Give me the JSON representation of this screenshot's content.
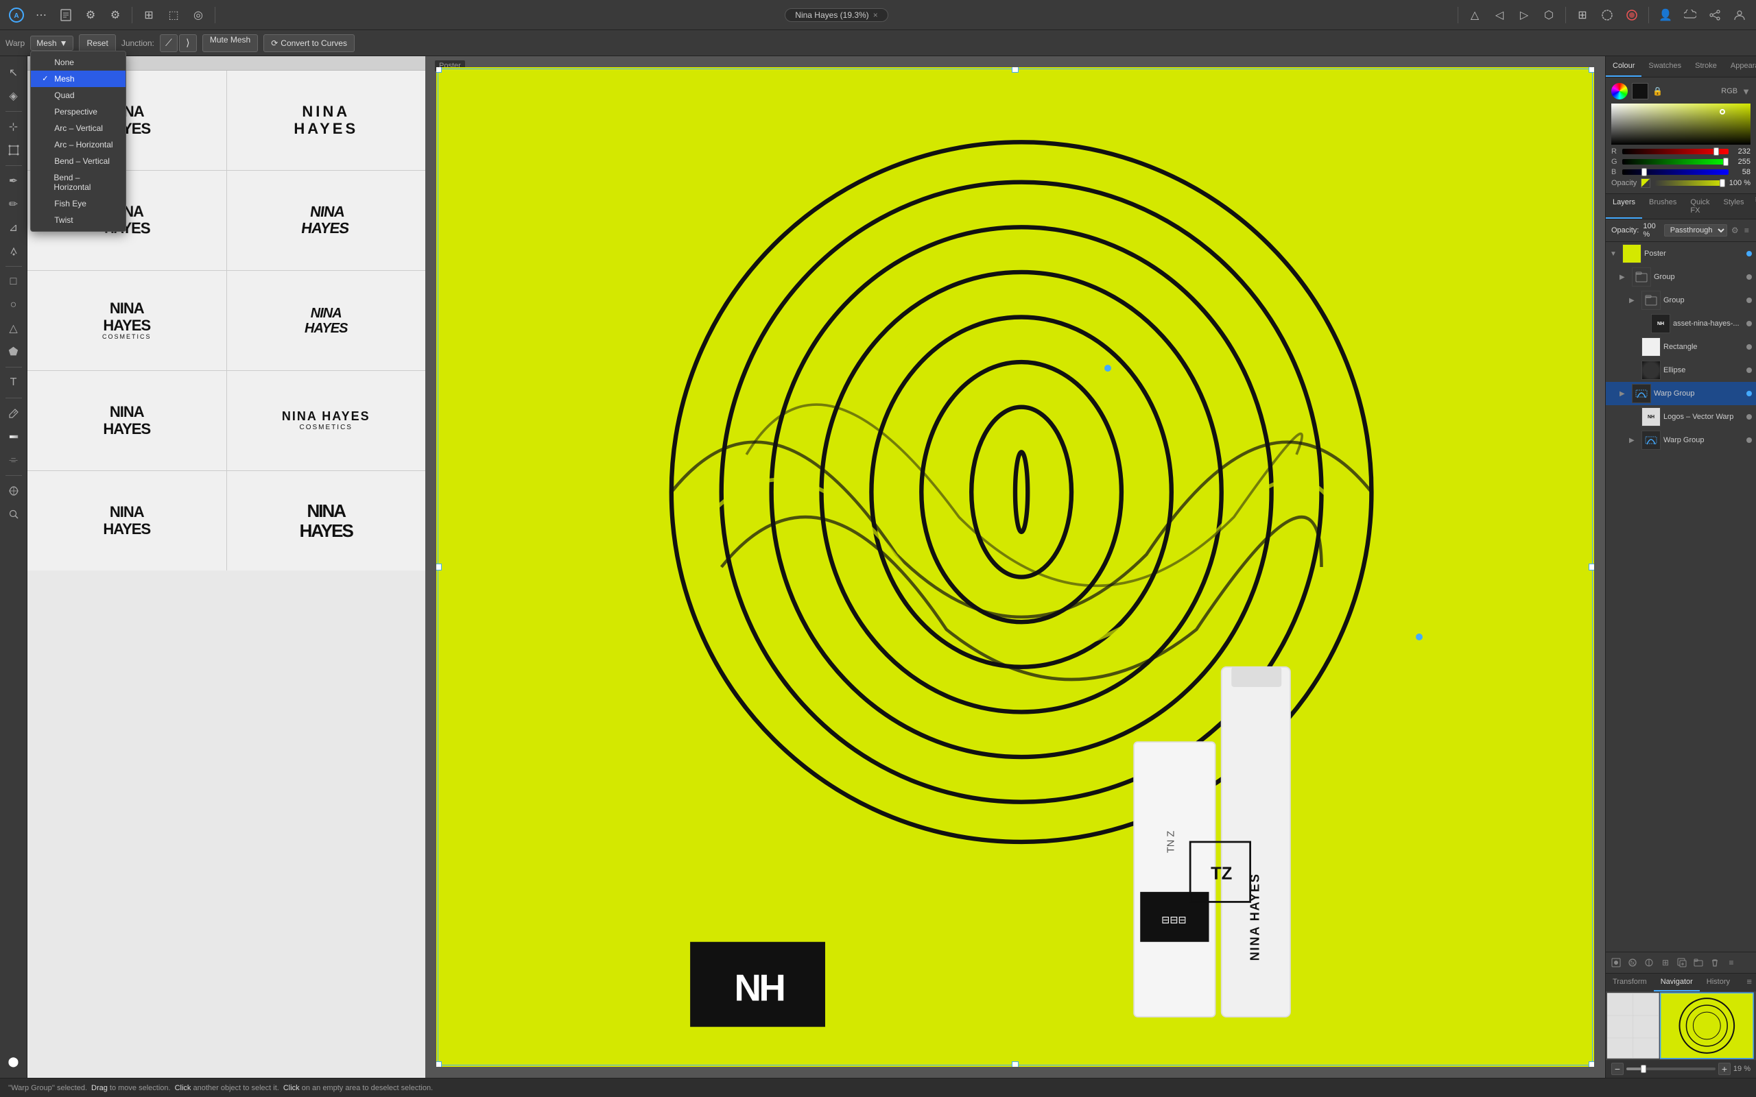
{
  "app": {
    "title": "Nina Hayes (19.3%)",
    "close_label": "×"
  },
  "top_toolbar": {
    "icons": [
      "⬡",
      "⊞",
      "⬚",
      "◎"
    ],
    "right_icons": [
      "△",
      "◁",
      "▷",
      "⬡",
      "✦",
      "☆",
      "⬡",
      "⬡",
      "⬡"
    ],
    "far_right_icons": [
      "👤",
      "🌐",
      "⚙"
    ]
  },
  "warp_toolbar": {
    "label": "Warp",
    "dropdown_label": "Mesh",
    "reset_label": "Reset",
    "junction_label": "Junction:",
    "mute_label": "Mute Mesh",
    "convert_label": "Convert to Curves",
    "menu_items": [
      {
        "id": "none",
        "label": "None",
        "active": false
      },
      {
        "id": "mesh",
        "label": "Mesh",
        "active": true
      },
      {
        "id": "quad",
        "label": "Quad",
        "active": false
      },
      {
        "id": "perspective",
        "label": "Perspective",
        "active": false
      },
      {
        "id": "arc-vertical",
        "label": "Arc – Vertical",
        "active": false
      },
      {
        "id": "arc-horizontal",
        "label": "Arc – Horizontal",
        "active": false
      },
      {
        "id": "bend-vertical",
        "label": "Bend – Vertical",
        "active": false
      },
      {
        "id": "bend-horizontal",
        "label": "Bend – Horizontal",
        "active": false
      },
      {
        "id": "fish-eye",
        "label": "Fish Eye",
        "active": false
      },
      {
        "id": "twist",
        "label": "Twist",
        "active": false
      }
    ]
  },
  "samples_panel": {
    "header": "Warp",
    "samples": [
      {
        "id": 1,
        "name": "NINA\nHAYES",
        "style": "normal"
      },
      {
        "id": 2,
        "name": "NINA\nHAYES",
        "style": "wide"
      },
      {
        "id": 3,
        "name": "NINA\nHAYES",
        "style": "slant"
      },
      {
        "id": 4,
        "name": "NINA\nHAYES",
        "style": "condensed"
      },
      {
        "id": 5,
        "name": "NINA\nHAYES\nCOSMETICS",
        "style": "sub"
      },
      {
        "id": 6,
        "name": "NINA\nHAYES",
        "style": "italic"
      },
      {
        "id": 7,
        "name": "NINA\nHAYES",
        "style": "normal"
      },
      {
        "id": 8,
        "name": "NINA HAYES\nCOSMETICS",
        "style": "script"
      },
      {
        "id": 9,
        "name": "NINA\nHAYES",
        "style": "normal"
      },
      {
        "id": 10,
        "name": "NINA\nHAYES",
        "style": "bold"
      }
    ]
  },
  "poster": {
    "label": "Poster",
    "bg_color": "#D4E800"
  },
  "right_panel": {
    "top_tabs": [
      "Colour",
      "Swatches",
      "Stroke",
      "Appearance"
    ],
    "active_top_tab": "Colour",
    "rgb_label": "RGB",
    "channels": [
      {
        "letter": "R",
        "value": 232,
        "pct": 91
      },
      {
        "letter": "G",
        "value": 255,
        "pct": 100
      },
      {
        "letter": "B",
        "value": 58,
        "pct": 23
      }
    ],
    "opacity_label": "Opacity",
    "opacity_value": "100 %",
    "layers_tabs": [
      "Layers",
      "Brushes",
      "Quick FX",
      "Styles"
    ],
    "active_layers_tab": "Layers",
    "blend_mode": "Passthrough",
    "layer_opacity": "100 %",
    "layers": [
      {
        "id": "poster",
        "name": "Poster",
        "indent": 0,
        "type": "layer",
        "thumb": "yellow",
        "expanded": true,
        "dot": true
      },
      {
        "id": "group1",
        "name": "Group",
        "indent": 1,
        "type": "group",
        "expanded": true,
        "dot": true
      },
      {
        "id": "group2",
        "name": "Group",
        "indent": 2,
        "type": "group",
        "expanded": true,
        "dot": true
      },
      {
        "id": "asset",
        "name": "asset-nina-hayes-...",
        "indent": 3,
        "type": "layer",
        "thumb": "logo",
        "dot": true
      },
      {
        "id": "rectangle",
        "name": "Rectangle",
        "indent": 2,
        "type": "shape",
        "thumb": "white",
        "dot": true
      },
      {
        "id": "ellipse",
        "name": "Ellipse",
        "indent": 2,
        "type": "shape",
        "thumb": "ellipse",
        "dot": true
      },
      {
        "id": "warp-group",
        "name": "Warp Group",
        "indent": 1,
        "type": "group",
        "expanded": true,
        "selected": true,
        "dot": true
      },
      {
        "id": "logos-vector",
        "name": "Logos – Vector Warp",
        "indent": 2,
        "type": "layer",
        "thumb": "white2",
        "dot": true
      },
      {
        "id": "warp-group2",
        "name": "Warp Group",
        "indent": 2,
        "type": "group",
        "dot": true
      }
    ],
    "footer_icons": [
      "⬡",
      "⊕",
      "⊞",
      "⊟",
      "◫",
      "≡",
      "⋮",
      "≡"
    ],
    "transform_tabs": [
      "Transform",
      "Navigator",
      "History"
    ],
    "active_transform_tab": "Navigator",
    "navigator_zoom": "19 %"
  },
  "status_bar": {
    "selected_text": "'Warp Group'",
    "selected_action": "selected.",
    "drag_text": "Drag",
    "drag_desc": "to move selection.",
    "click_text": "Click",
    "click_desc": "another object to select it.",
    "click2_text": "Click",
    "click2_desc": "on an empty area to deselect selection."
  }
}
